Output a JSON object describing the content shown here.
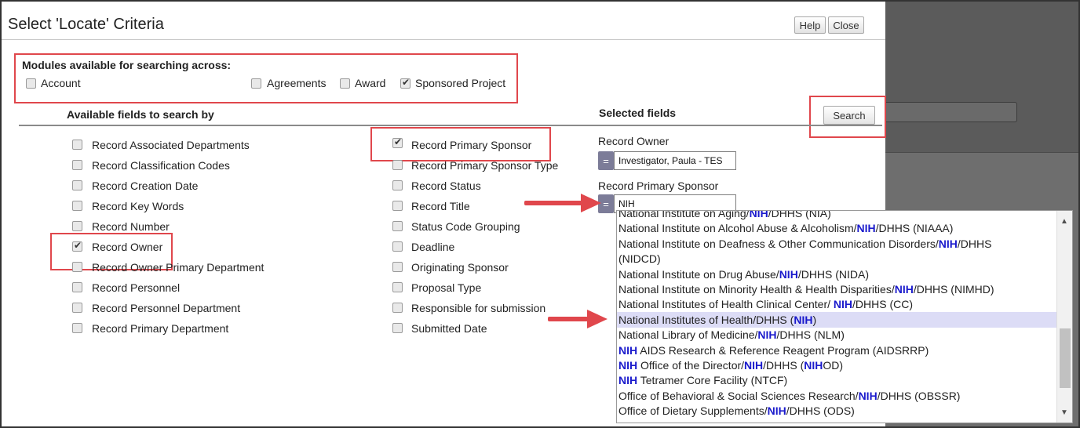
{
  "dialog": {
    "title": "Select 'Locate' Criteria",
    "help_label": "Help",
    "close_label": "Close"
  },
  "modules": {
    "title": "Modules available for searching across:",
    "items": [
      {
        "label": "Account",
        "checked": false
      },
      {
        "label": "Agreements",
        "checked": false
      },
      {
        "label": "Award",
        "checked": false
      },
      {
        "label": "Sponsored Project",
        "checked": true
      }
    ]
  },
  "available": {
    "header": "Available fields to search by",
    "col1": [
      {
        "label": "Record Associated Departments",
        "checked": false
      },
      {
        "label": "Record Classification Codes",
        "checked": false
      },
      {
        "label": "Record Creation Date",
        "checked": false
      },
      {
        "label": "Record Key Words",
        "checked": false
      },
      {
        "label": "Record Number",
        "checked": false
      },
      {
        "label": "Record Owner",
        "checked": true
      },
      {
        "label": "Record Owner Primary Department",
        "checked": false
      },
      {
        "label": "Record Personnel",
        "checked": false
      },
      {
        "label": "Record Personnel Department",
        "checked": false
      },
      {
        "label": "Record Primary Department",
        "checked": false
      }
    ],
    "col2": [
      {
        "label": "Record Primary Sponsor",
        "checked": true
      },
      {
        "label": "Record Primary Sponsor Type",
        "checked": false
      },
      {
        "label": "Record Status",
        "checked": false
      },
      {
        "label": "Record Title",
        "checked": false
      },
      {
        "label": "Status Code Grouping",
        "checked": false
      },
      {
        "label": "Deadline",
        "checked": false
      },
      {
        "label": "Originating Sponsor",
        "checked": false
      },
      {
        "label": "Proposal Type",
        "checked": false
      },
      {
        "label": "Responsible for submission",
        "checked": false
      },
      {
        "label": "Submitted Date",
        "checked": false
      }
    ]
  },
  "selected": {
    "header": "Selected fields",
    "search_label": "Search",
    "operator": "=",
    "fields": [
      {
        "label": "Record Owner",
        "value": "Investigator, Paula - TES"
      },
      {
        "label": "Record Primary Sponsor",
        "value": "NIH"
      }
    ]
  },
  "dropdown": {
    "selected_index": 7,
    "items": [
      "National Institute on Aging/<b>NIH</b>/DHHS (NIA)",
      "National Institute on Alcohol Abuse &amp; Alcoholism/<b>NIH</b>/DHHS (NIAAA)",
      "National Institute on Deafness &amp; Other Communication Disorders/<b>NIH</b>/DHHS",
      "(NIDCD)",
      "National Institute on Drug Abuse/<b>NIH</b>/DHHS (NIDA)",
      "National Institute on Minority Health &amp; Health Disparities/<b>NIH</b>/DHHS (NIMHD)",
      "National Institutes of Health Clinical Center/ <b>NIH</b>/DHHS (CC)",
      "National Institutes of Health/DHHS (<b>NIH</b>)",
      "National Library of Medicine/<b>NIH</b>/DHHS (NLM)",
      "<b>NIH</b> AIDS Research &amp; Reference Reagent Program (AIDSRRP)",
      "<b>NIH</b> Office of the Director/<b>NIH</b>/DHHS (<b>NIH</b>OD)",
      "<b>NIH</b> Tetramer Core Facility (NTCF)",
      "Office of Behavioral &amp; Social Sciences Research/<b>NIH</b>/DHHS (OBSSR)",
      "Office of Dietary Supplements/<b>NIH</b>/DHHS (ODS)"
    ]
  },
  "colors": {
    "highlight_red": "#e0474c",
    "match_blue": "#1a1acc",
    "selected_row": "#dcdcf6"
  }
}
